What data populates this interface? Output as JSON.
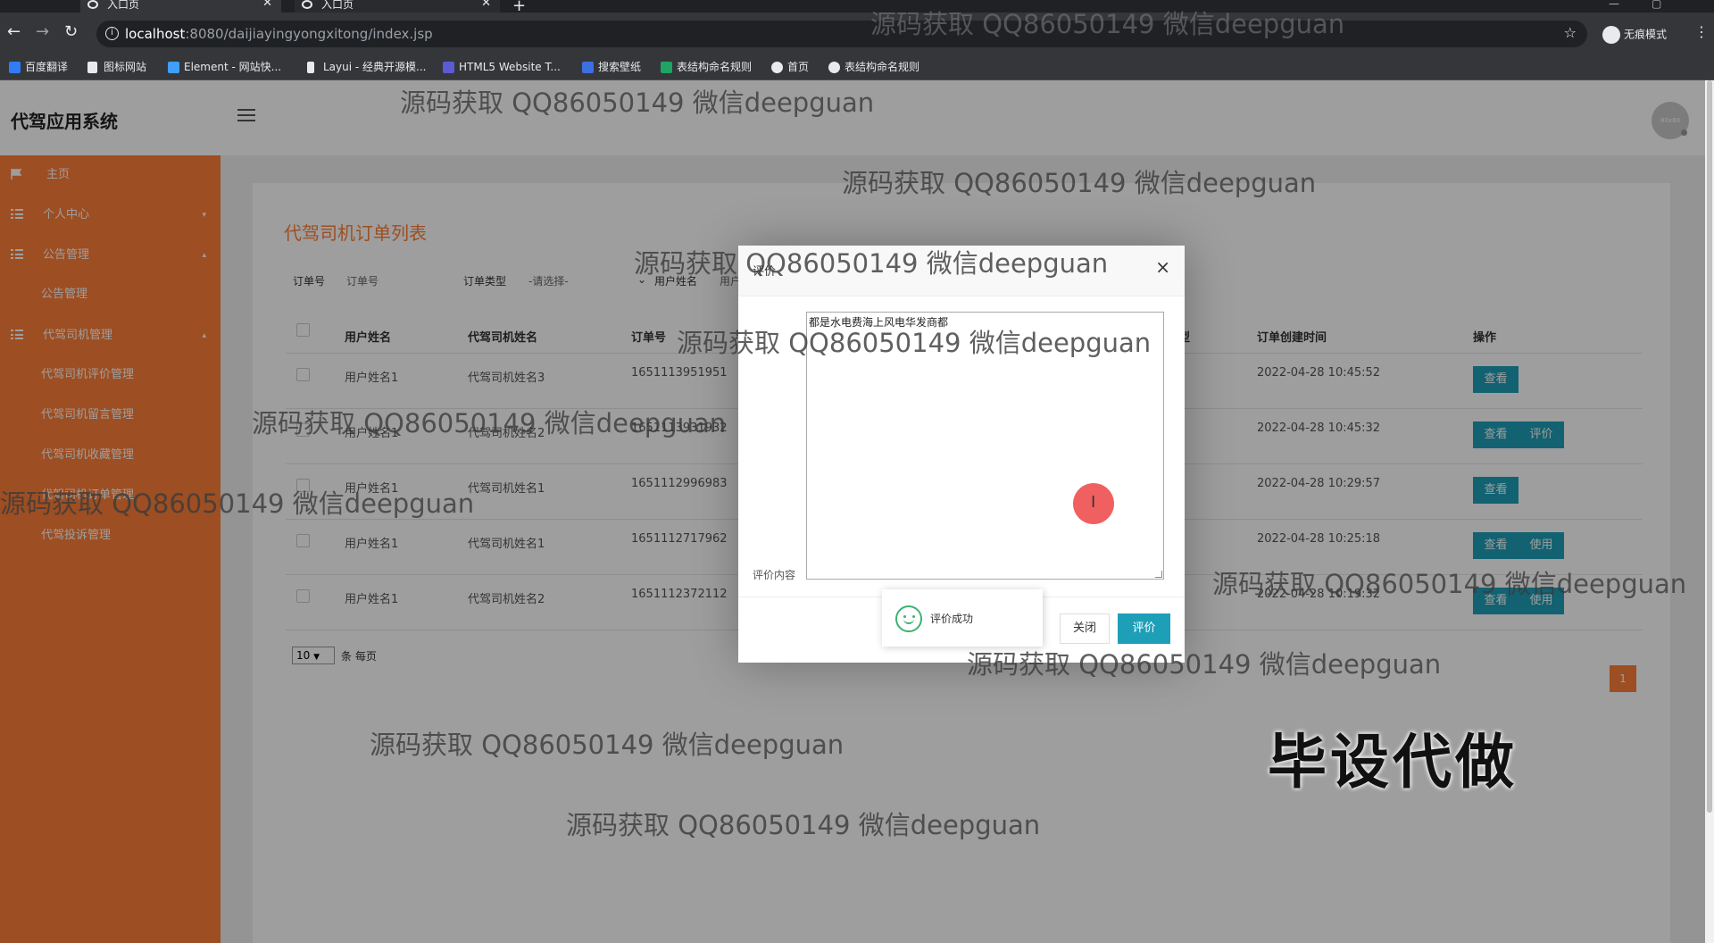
{
  "browser": {
    "tabs": [
      {
        "title": "入口页"
      },
      {
        "title": "入口页"
      }
    ],
    "url_host": "localhost",
    "url_path": ":8080/daijiayingyongxitong/index.jsp",
    "incognito_label": "无痕模式",
    "bookmarks": [
      {
        "label": "百度翻译",
        "color": "#2f7cf6"
      },
      {
        "label": "图标网站",
        "color": "#e8eaed"
      },
      {
        "label": "Element - 网站快...",
        "color": "#409eff"
      },
      {
        "label": "Layui - 经典开源模...",
        "color": "#e8eaed"
      },
      {
        "label": "HTML5 Website T...",
        "color": "#5b5bd6"
      },
      {
        "label": "搜索壁纸",
        "color": "#3d6fe0"
      },
      {
        "label": "表结构命名规则",
        "color": "#1fa463"
      },
      {
        "label": "首页",
        "color": "#e8eaed"
      },
      {
        "label": "表结构命名规则",
        "color": "#e8eaed"
      }
    ]
  },
  "app": {
    "title": "代驾应用系统",
    "avatar_text": "80x80"
  },
  "sidebar": {
    "items": [
      {
        "label": "主页",
        "icon": "flag-icon"
      },
      {
        "label": "个人中心",
        "icon": "grid-icon",
        "arrow": "▾"
      },
      {
        "label": "公告管理",
        "icon": "grid-icon",
        "arrow": "▴"
      },
      {
        "label": "公告管理",
        "sub": true
      },
      {
        "label": "代驾司机管理",
        "icon": "grid-icon",
        "arrow": "▴"
      },
      {
        "label": "代驾司机评价管理",
        "sub": true
      },
      {
        "label": "代驾司机留言管理",
        "sub": true
      },
      {
        "label": "代驾司机收藏管理",
        "sub": true
      },
      {
        "label": "代驾司机订单管理",
        "sub": true
      },
      {
        "label": "代驾投诉管理",
        "sub": true
      }
    ]
  },
  "main": {
    "panel_title": "代驾司机订单列表",
    "search": {
      "order_no_label": "订单号",
      "order_no_placeholder": "订单号",
      "order_type_label": "订单类型",
      "order_type_value": "-请选择-",
      "username_label": "用户姓名",
      "username_placeholder": "用户"
    },
    "columns": [
      "用户姓名",
      "代驾司机姓名",
      "订单号",
      "型",
      "订单创建时间",
      "操作"
    ],
    "rows": [
      {
        "user": "用户姓名1",
        "driver": "代驾司机姓名3",
        "order_no": "1651113951951",
        "created": "2022-04-28 10:45:52",
        "actions": [
          "查看"
        ]
      },
      {
        "user": "用户姓名1",
        "driver": "代驾司机姓名2",
        "order_no": "1651113931932",
        "created": "2022-04-28 10:45:32",
        "actions": [
          "查看",
          "评价"
        ]
      },
      {
        "user": "用户姓名1",
        "driver": "代驾司机姓名1",
        "order_no": "1651112996983",
        "created": "2022-04-28 10:29:57",
        "actions": [
          "查看"
        ]
      },
      {
        "user": "用户姓名1",
        "driver": "代驾司机姓名1",
        "order_no": "1651112717962",
        "created": "2022-04-28 10:25:18",
        "actions": [
          "查看",
          "使用"
        ]
      },
      {
        "user": "用户姓名1",
        "driver": "代驾司机姓名2",
        "order_no": "1651112372112",
        "created": "2022-04-28 10:19:32",
        "actions": [
          "查看",
          "使用"
        ]
      }
    ],
    "page_size": "10",
    "page_size_label": "条 每页",
    "current_page": "1"
  },
  "dialog": {
    "title": "评价",
    "close_icon": "×",
    "field_label": "评价内容",
    "content": "都是水电费海上风电华发商都",
    "close_label": "关闭",
    "submit_label": "评价"
  },
  "toast": {
    "message": "评价成功"
  },
  "watermarks": {
    "text": "源码获取 QQ86050149 微信deepguan",
    "big": "毕设代做"
  },
  "colors": {
    "accent": "#fe7f38",
    "button": "#1e9fb8"
  }
}
